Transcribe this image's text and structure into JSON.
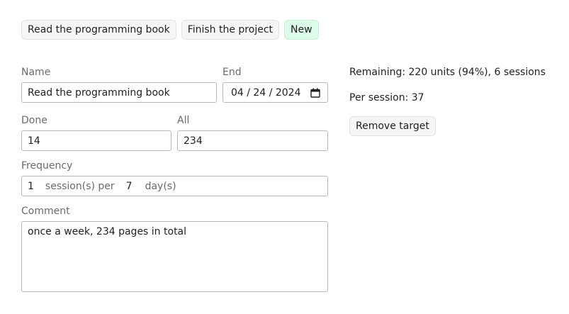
{
  "tabs": [
    {
      "label": "Read the programming book"
    },
    {
      "label": "Finish the project"
    },
    {
      "label": "New"
    }
  ],
  "form": {
    "name_label": "Name",
    "name_value": "Read the programming book",
    "end_label": "End",
    "end_value": "04 / 24 / 2024",
    "done_label": "Done",
    "done_value": "14",
    "all_label": "All",
    "all_value": "234",
    "frequency_label": "Frequency",
    "frequency_sessions": "1",
    "frequency_sessions_unit": "session(s) per",
    "frequency_days": "7",
    "frequency_days_unit": "day(s)",
    "comment_label": "Comment",
    "comment_value": "once a week, 234 pages in total"
  },
  "summary": {
    "remaining": "Remaining: 220 units (94%), 6 sessions",
    "per_session": "Per session: 37",
    "remove_button": "Remove target"
  },
  "colors": {
    "new_tab_background": "#ddfbe9",
    "tab_background": "#f6f6f6",
    "label_text": "#6b6b6b"
  },
  "icons": {
    "end_date": "calendar-icon"
  }
}
